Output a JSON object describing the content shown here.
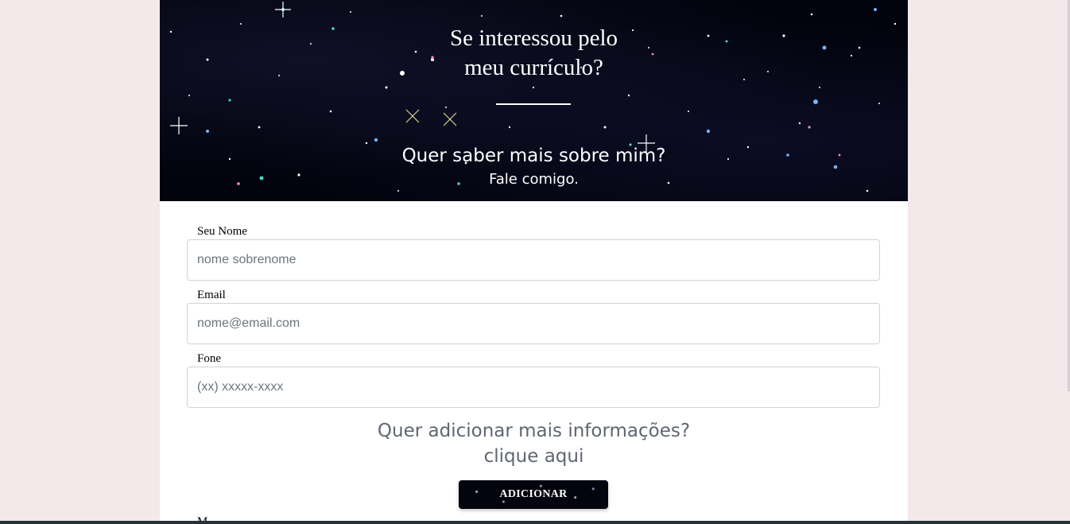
{
  "hero": {
    "title_line1": "Se interessou pelo",
    "title_line2": "meu currículo?",
    "subtitle": "Quer saber mais sobre mim?",
    "subtitle2": "Fale comigo."
  },
  "form": {
    "name_label": "Seu Nome",
    "name_placeholder": "nome sobrenome",
    "email_label": "Email",
    "email_placeholder": "nome@email.com",
    "phone_label": "Fone",
    "phone_placeholder": "(xx) xxxxx-xxxx",
    "more_question": "Quer adicionar mais informações?",
    "more_hint": "clique aqui",
    "add_button": "ADICIONAR",
    "next_label_cut": "M"
  },
  "colors": {
    "page_background": "#f3e8ea",
    "hero_background": "#02030c",
    "muted_text": "#5f6670"
  }
}
